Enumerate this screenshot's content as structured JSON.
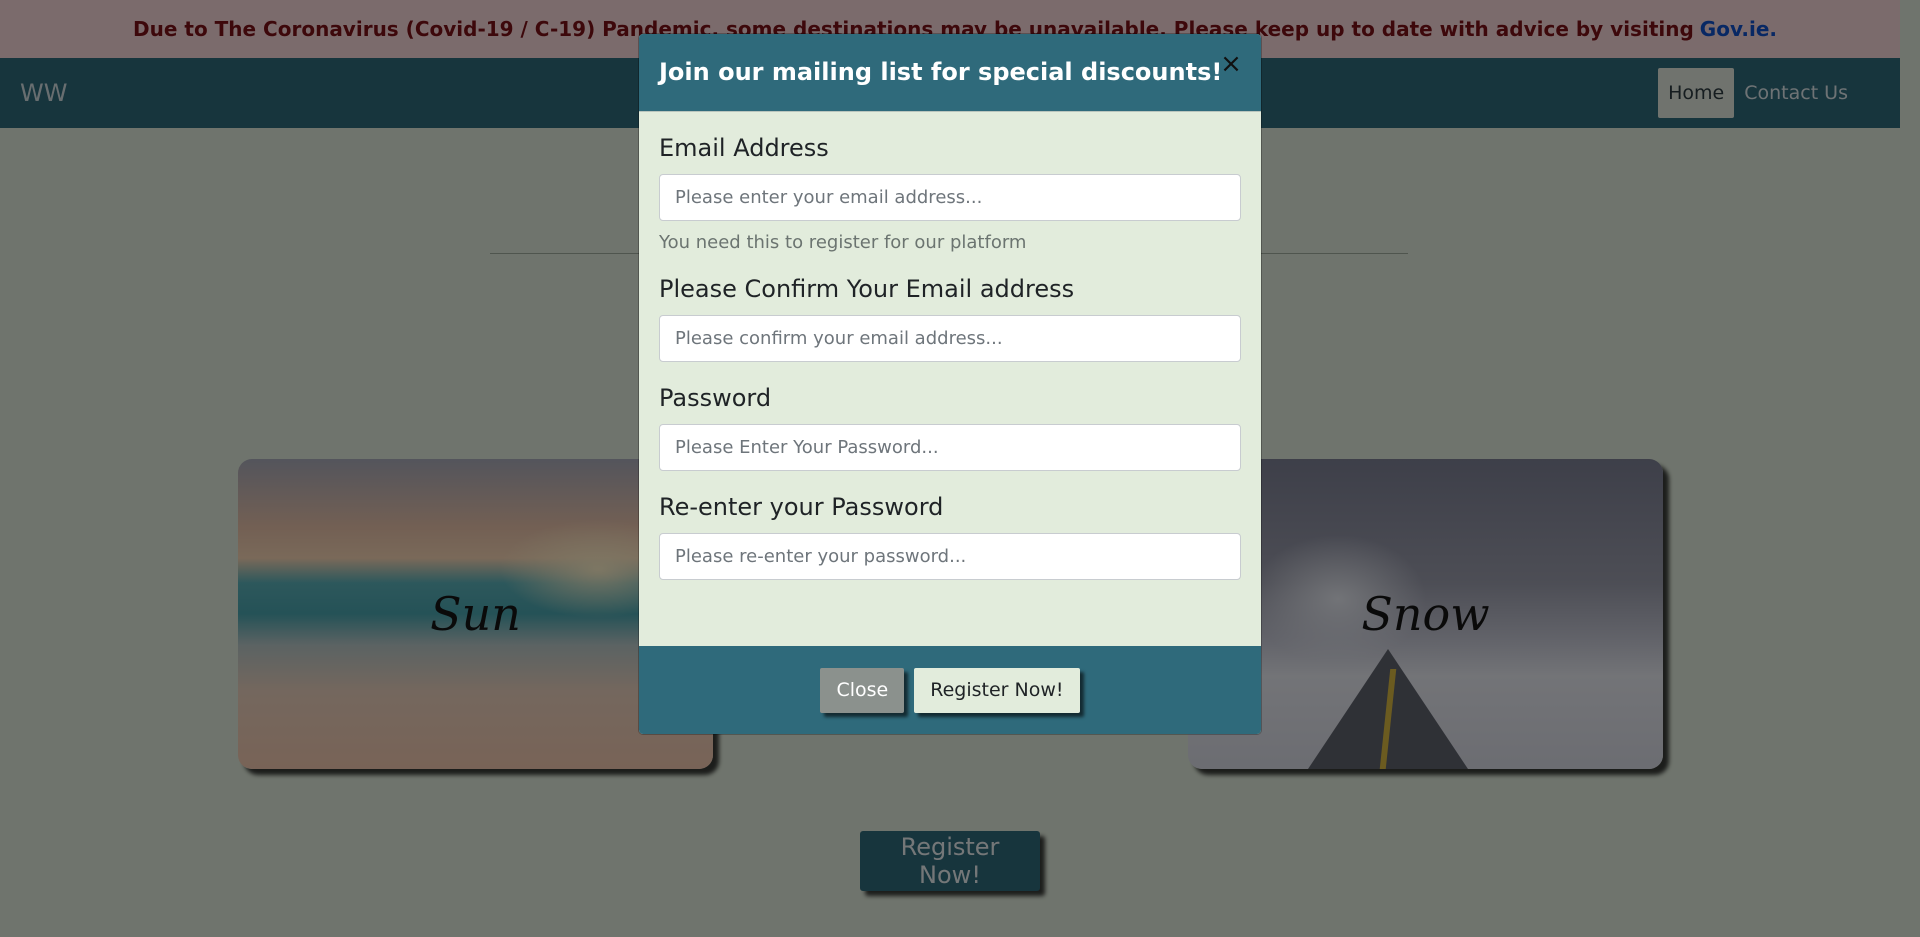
{
  "banner": {
    "message": "Due to The Coronavirus (Covid-19 / C-19) Pandemic, some destinations may be unavailable. Please keep up to date with advice by visiting",
    "link_text": "Gov.ie."
  },
  "navbar": {
    "brand": "WW",
    "links": [
      {
        "label": "Home",
        "active": true
      },
      {
        "label": "Contact Us",
        "active": false
      }
    ]
  },
  "cards": [
    {
      "title": "Sun"
    },
    {
      "title": "Snow"
    }
  ],
  "page": {
    "register_button": "Register Now!"
  },
  "modal": {
    "title": "Join our mailing list for special discounts!",
    "close_symbol": "×",
    "fields": [
      {
        "label": "Email Address",
        "placeholder": "Please enter your email address...",
        "value": "",
        "help": "You need this to register for our platform"
      },
      {
        "label": "Please Confirm Your Email address",
        "placeholder": "Please confirm your email address...",
        "value": ""
      },
      {
        "label": "Password",
        "placeholder": "Please Enter Your Password...",
        "value": ""
      },
      {
        "label": "Re-enter your Password",
        "placeholder": "Please re-enter your password...",
        "value": ""
      }
    ],
    "buttons": {
      "close": "Close",
      "register": "Register Now!"
    }
  },
  "colors": {
    "primary": "#2f6a7b",
    "modal_background": "#e2ecdc",
    "banner_background": "#f7d6d8",
    "banner_text": "#7b1016",
    "link": "#1150c8"
  }
}
